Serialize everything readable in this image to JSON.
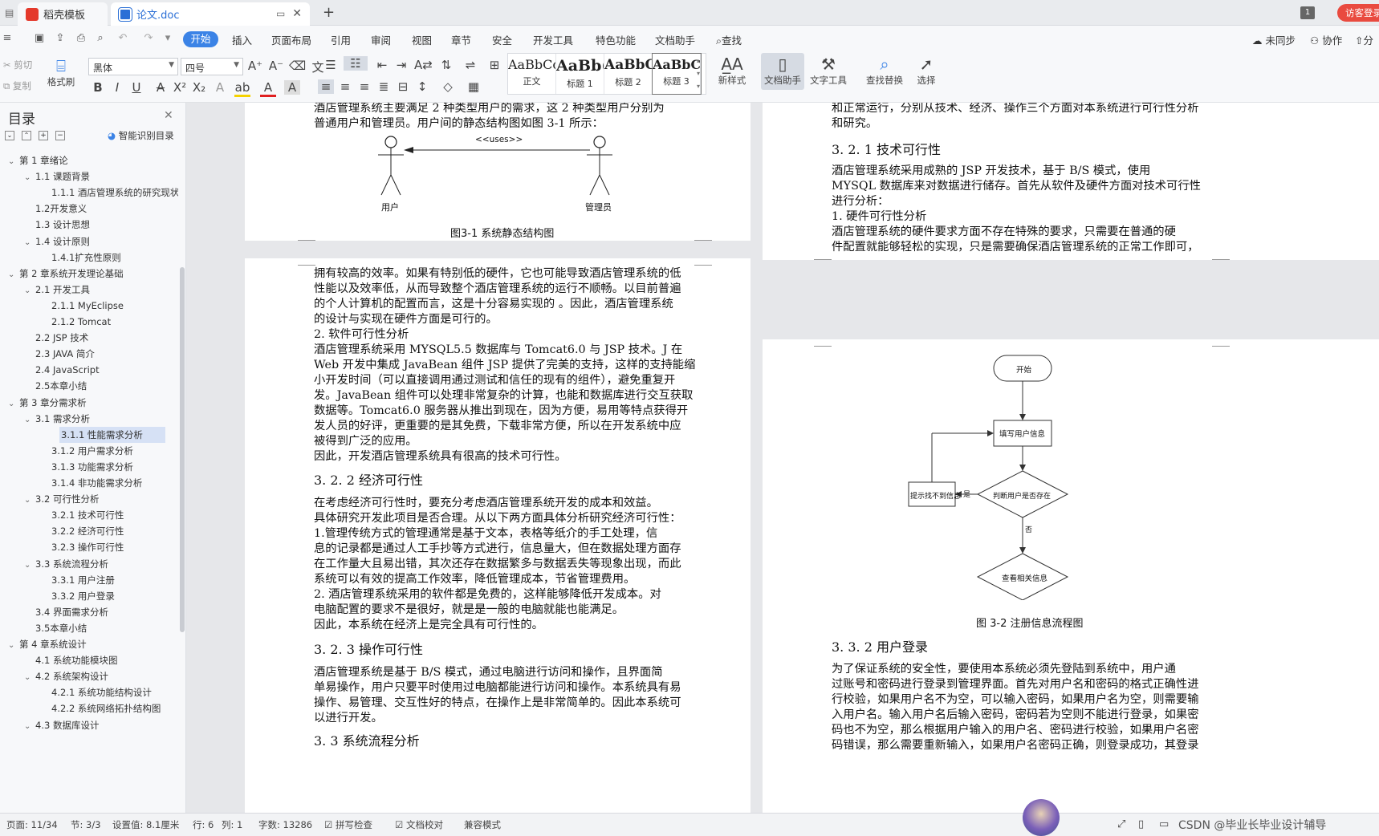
{
  "titlebar": {
    "tabs": [
      {
        "label": "稻壳模板",
        "icon": "wps-icon",
        "color": "#e4392b"
      },
      {
        "label": "论文.doc",
        "icon": "word-doc-icon",
        "color": "#2b6fd6"
      }
    ],
    "page_badge": "1",
    "login_button": "访客登录"
  },
  "menu": {
    "items": [
      "开始",
      "插入",
      "页面布局",
      "引用",
      "审阅",
      "视图",
      "章节",
      "安全",
      "开发工具",
      "特色功能",
      "文档助手"
    ],
    "active": "开始",
    "search": "查找",
    "right": [
      "未同步",
      "协作",
      "分"
    ]
  },
  "ribbon": {
    "cut": "剪切",
    "copy": "复制",
    "format_painter": "格式刷",
    "font_name": "黑体",
    "font_size": "四号",
    "styles": [
      {
        "preview": "AaBbCcI",
        "label": "正文"
      },
      {
        "preview": "AaBb(",
        "label": "标题 1"
      },
      {
        "preview": "AaBbC",
        "label": "标题 2"
      },
      {
        "preview": "AaBbC",
        "label": "标题 3"
      }
    ],
    "new_style": "新样式",
    "doc_helper": "文档助手",
    "text_tools": "文字工具",
    "find_replace": "查找替换",
    "select": "选择"
  },
  "sidebar": {
    "title": "目录",
    "smart_toc": "智能识别目录",
    "items": [
      {
        "label": "第 1 章绪论",
        "level": 0,
        "toggle": "v"
      },
      {
        "label": "1.1  课题背景",
        "level": 1,
        "toggle": "v"
      },
      {
        "label": "1.1.1  酒店管理系统的研究现状",
        "level": 2,
        "toggle": ""
      },
      {
        "label": "1.2开发意义",
        "level": 1,
        "toggle": ""
      },
      {
        "label": "1.3  设计思想",
        "level": 1,
        "toggle": ""
      },
      {
        "label": "1.4  设计原则",
        "level": 1,
        "toggle": "v"
      },
      {
        "label": "1.4.1扩充性原则",
        "level": 2,
        "toggle": ""
      },
      {
        "label": "第 2 章系统开发理论基础",
        "level": 0,
        "toggle": "v"
      },
      {
        "label": "2.1  开发工具",
        "level": 1,
        "toggle": "v"
      },
      {
        "label": "2.1.1  MyEclipse",
        "level": 2,
        "toggle": ""
      },
      {
        "label": "2.1.2  Tomcat",
        "level": 2,
        "toggle": ""
      },
      {
        "label": "2.2  JSP 技术",
        "level": 1,
        "toggle": ""
      },
      {
        "label": "2.3  JAVA 简介",
        "level": 1,
        "toggle": ""
      },
      {
        "label": "2.4  JavaScript",
        "level": 1,
        "toggle": ""
      },
      {
        "label": "2.5本章小结",
        "level": 1,
        "toggle": ""
      },
      {
        "label": "第 3 章分需求析",
        "level": 0,
        "toggle": "v"
      },
      {
        "label": "3.1  需求分析",
        "level": 1,
        "toggle": "v"
      },
      {
        "label": "3.1.1  性能需求分析",
        "level": 2,
        "toggle": "",
        "selected": true
      },
      {
        "label": "3.1.2  用户需求分析",
        "level": 2,
        "toggle": ""
      },
      {
        "label": "3.1.3  功能需求分析",
        "level": 2,
        "toggle": ""
      },
      {
        "label": "3.1.4  非功能需求分析",
        "level": 2,
        "toggle": ""
      },
      {
        "label": "3.2  可行性分析",
        "level": 1,
        "toggle": "v"
      },
      {
        "label": "3.2.1  技术可行性",
        "level": 2,
        "toggle": ""
      },
      {
        "label": "3.2.2  经济可行性",
        "level": 2,
        "toggle": ""
      },
      {
        "label": "3.2.3  操作可行性",
        "level": 2,
        "toggle": ""
      },
      {
        "label": "3.3  系统流程分析",
        "level": 1,
        "toggle": "v"
      },
      {
        "label": "3.3.1  用户注册",
        "level": 2,
        "toggle": ""
      },
      {
        "label": "3.3.2  用户登录",
        "level": 2,
        "toggle": ""
      },
      {
        "label": "3.4  界面需求分析",
        "level": 1,
        "toggle": ""
      },
      {
        "label": "3.5本章小结",
        "level": 1,
        "toggle": ""
      },
      {
        "label": "第 4 章系统设计",
        "level": 0,
        "toggle": "v"
      },
      {
        "label": "4.1  系统功能模块图",
        "level": 1,
        "toggle": ""
      },
      {
        "label": "4.2  系统架构设计",
        "level": 1,
        "toggle": "v"
      },
      {
        "label": "4.2.1  系统功能结构设计",
        "level": 2,
        "toggle": ""
      },
      {
        "label": "4.2.2  系统网络拓扑结构图",
        "level": 2,
        "toggle": ""
      },
      {
        "label": "4.3  数据库设计",
        "level": 1,
        "toggle": "v"
      }
    ]
  },
  "page1": {
    "lines": [
      "    酒店管理系统主要满足 2 种类型用户的需求，这 2 种类型用户分别为",
      "普通用户和管理员。用户间的静态结构图如图 3-1 所示："
    ],
    "diagram": {
      "uses": "<<uses>>",
      "actor1": "用户",
      "actor2": "管理员"
    },
    "caption": "图3-1 系统静态结构图"
  },
  "page2": {
    "lines": [
      "拥有较高的效率。如果有特别低的硬件，它也可能导致酒店管理系统的低",
      "性能以及效率低，从而导致整个酒店管理系统的运行不顺畅。以目前普遍",
      "的个人计算机的配置而言，这是十分容易实现的  。因此，酒店管理系统",
      "的设计与实现在硬件方面是可行的。",
      "    2.  软件可行性分析",
      "    酒店管理系统采用 MYSQL5.5 数据库与 Tomcat6.0 与 JSP 技术。J 在",
      "Web 开发中集成 JavaBean 组件 JSP 提供了完美的支持，这样的支持能缩",
      "小开发时间（可以直接调用通过测试和信任的现有的组件），避免重复开",
      "发。JavaBean 组件可以处理非常复杂的计算，也能和数据库进行交互获取",
      "数据等。Tomcat6.0 服务器从推出到现在，因为方便，易用等特点获得开",
      "发人员的好评，更重要的是其免费，下载非常方便，所以在开发系统中应",
      "被得到广泛的应用。",
      "    因此，开发酒店管理系统具有很高的技术可行性。"
    ],
    "h_economic": "3. 2. 2    经济可行性",
    "lines2": [
      "    在考虑经济可行性时，要充分考虑酒店管理系统开发的成本和效益。",
      "具体研究开发此项目是否合理。从以下两方面具体分析研究经济可行性：",
      "    1.管理传统方式的管理通常是基于文本，表格等纸介的手工处理，信",
      "息的记录都是通过人工手抄等方式进行，信息量大，但在数据处理方面存",
      "在工作量大且易出错，其次还存在数据繁多与数据丢失等现象出现，而此",
      "系统可以有效的提高工作效率，降低管理成本，节省管理费用。",
      "    2.  酒店管理系统采用的软件都是免费的，这样能够降低开发成本。对",
      "电脑配置的要求不是很好，就是是一般的电脑就能也能满足。",
      "    因此，本系统在经济上是完全具有可行性的。"
    ],
    "h_operation": "3. 2. 3    操作可行性",
    "lines3": [
      "    酒店管理系统是基于 B/S 模式，通过电脑进行访问和操作，且界面简",
      "单易操作，用户只要平时使用过电脑都能进行访问和操作。本系统具有易",
      "操作、易管理、交互性好的特点，在操作上是非常简单的。因此本系统可",
      "以进行开发。"
    ],
    "h_process": "3. 3    系统流程分析"
  },
  "page3": {
    "lines": [
      "和正常运行，分别从技术、经济、操作三个方面对本系统进行可行性分析",
      "和研究。"
    ],
    "h_tech": "3. 2. 1    技术可行性",
    "lines2": [
      "    酒店管理系统采用成熟的 JSP 开发技术，基于 B/S 模式，使用",
      "MYSQL 数据库来对数据进行储存。首先从软件及硬件方面对技术可行性",
      "进行分析：",
      "    1.  硬件可行性分析",
      "    酒店管理系统的硬件要求方面不存在特殊的要求，只需要在普通的硬",
      "件配置就能够轻松的实现，只是需要确保酒店管理系统的正常工作即可，"
    ]
  },
  "page4": {
    "flow": {
      "start": "开始",
      "fill": "填写用户信息",
      "judge": "判断用户是否存在",
      "prompt": "提示找不到信息",
      "view": "查看相关信息",
      "yes": "是",
      "no": "否"
    },
    "caption": "图 3-2 注册信息流程图",
    "h_login": "3. 3. 2    用户登录",
    "lines": [
      "    为了保证系统的安全性，要使用本系统必须先登陆到系统中，用户通",
      "过账号和密码进行登录到管理界面。首先对用户名和密码的格式正确性进",
      "行校验，如果用户名不为空，可以输入密码，如果用户名为空，则需要输",
      "入用户名。输入用户名后输入密码，密码若为空则不能进行登录，如果密",
      "码也不为空，那么根据用户输入的用户名、密码进行校验，如果用户名密",
      "码错误，那么需要重新输入，如果用户名密码正确，则登录成功，其登录"
    ]
  },
  "status": {
    "page": "页面: 11/34",
    "section": "节: 3/3",
    "setting": "设置值: 8.1厘米",
    "row": "行: 6",
    "col": "列: 1",
    "words": "字数: 13286",
    "spell": "拼写检查",
    "proof": "文档校对",
    "compat": "兼容模式",
    "watermark": "CSDN @毕业长毕业设计辅导"
  }
}
